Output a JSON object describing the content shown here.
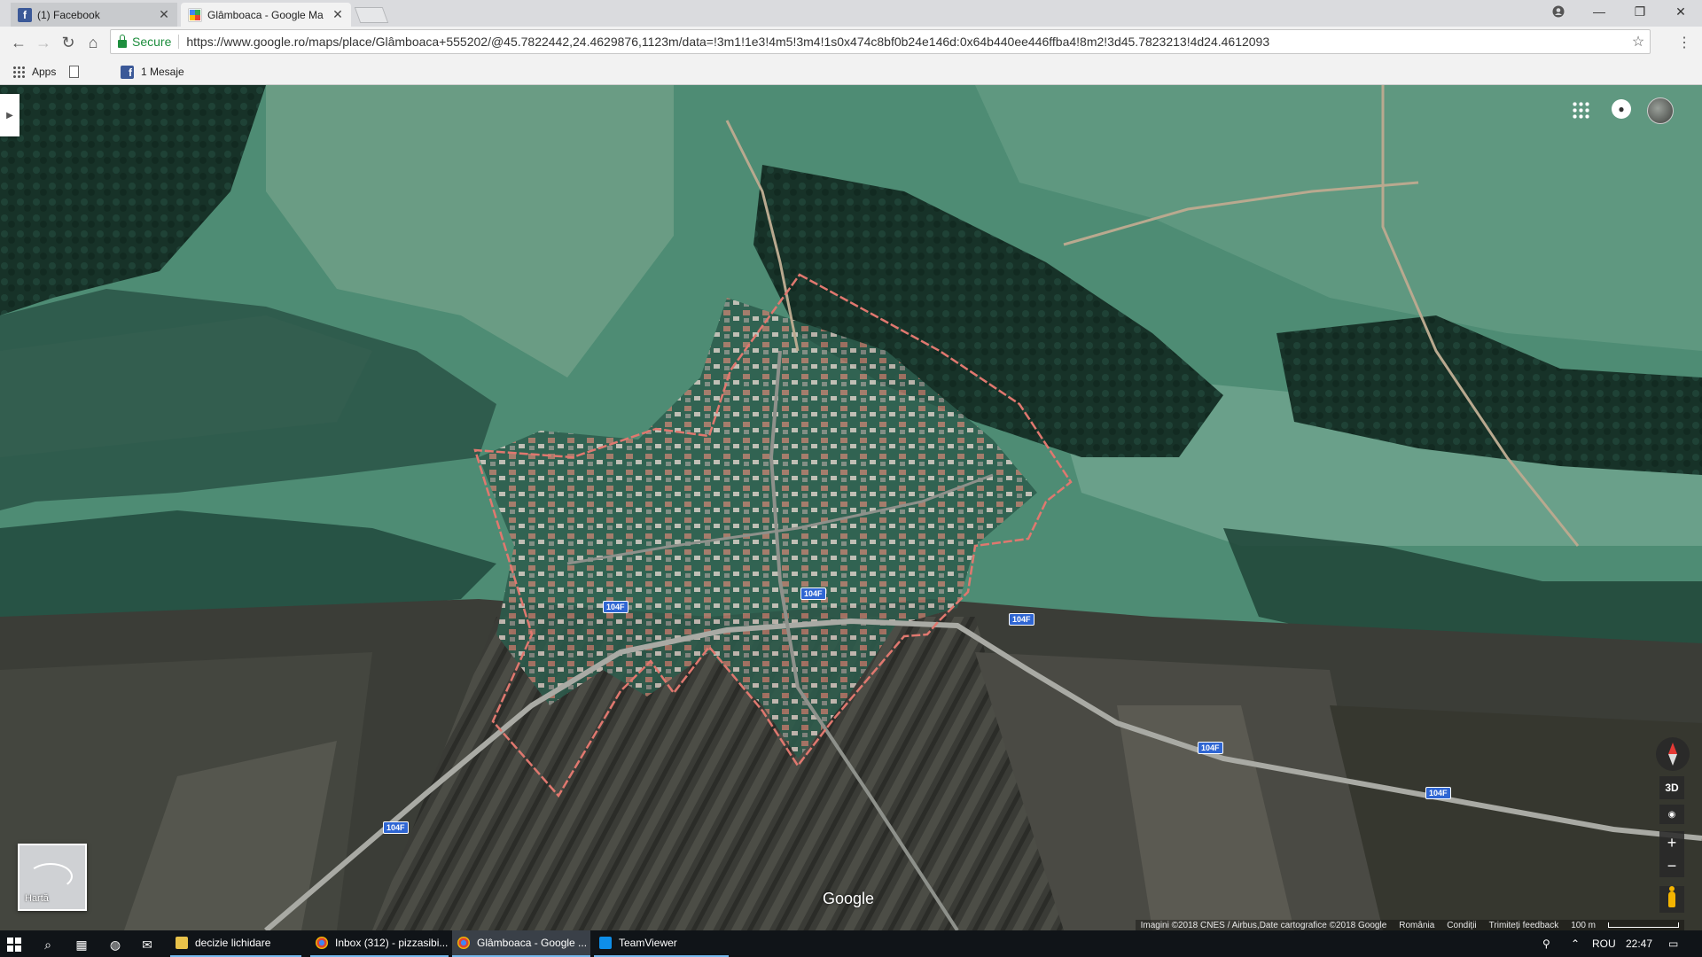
{
  "browser": {
    "tabs": [
      {
        "title": "(1) Facebook",
        "icon": "facebook-icon",
        "active": false
      },
      {
        "title": "Glâmboaca - Google Ma",
        "icon": "google-maps-icon",
        "active": true
      }
    ],
    "window_controls": [
      "account-icon",
      "minimize-icon",
      "maximize-icon",
      "close-icon"
    ],
    "address": {
      "secure_label": "Secure",
      "url": "https://www.google.ro/maps/place/Glâmboaca+555202/@45.7822442,24.4629876,1123m/data=!3m1!1e3!4m5!3m4!1s0x474c8bf0b24e146d:0x64b440ee446ffba4!8m2!3d45.7823213!4d24.4612093"
    },
    "bookmarks": [
      {
        "label": "Apps",
        "icon": "apps-grid-icon"
      },
      {
        "label": "",
        "icon": "page-icon"
      },
      {
        "label": "1 Mesaje",
        "icon": "facebook-icon"
      }
    ]
  },
  "map": {
    "view": "satellite",
    "road_labels": [
      "104F",
      "104F",
      "104F",
      "104F",
      "104F",
      "104F"
    ],
    "layer_switch_label": "Hartă",
    "controls": {
      "tilt_label": "3D",
      "zoom_in": "+",
      "zoom_out": "−"
    },
    "logo": "Google",
    "attribution": {
      "imagery": "Imagini ©2018 CNES / Airbus,Date cartografice ©2018 Google",
      "country": "România",
      "terms": "Condiții",
      "feedback": "Trimiteți feedback",
      "scale": "100 m"
    },
    "colors": {
      "boundary": "#e0786f",
      "road_shield": "#2f66d3"
    }
  },
  "taskbar": {
    "apps": [
      {
        "label": "decizie lichidare",
        "icon": "folder-icon",
        "active": false
      },
      {
        "label": "Inbox (312) - pizzasibi...",
        "icon": "chrome-icon",
        "active": false
      },
      {
        "label": "Glâmboaca - Google ...",
        "icon": "chrome-icon",
        "active": true
      },
      {
        "label": "TeamViewer",
        "icon": "teamviewer-icon",
        "active": false
      }
    ],
    "tray": {
      "language": "ROU",
      "time": "22:47"
    }
  }
}
